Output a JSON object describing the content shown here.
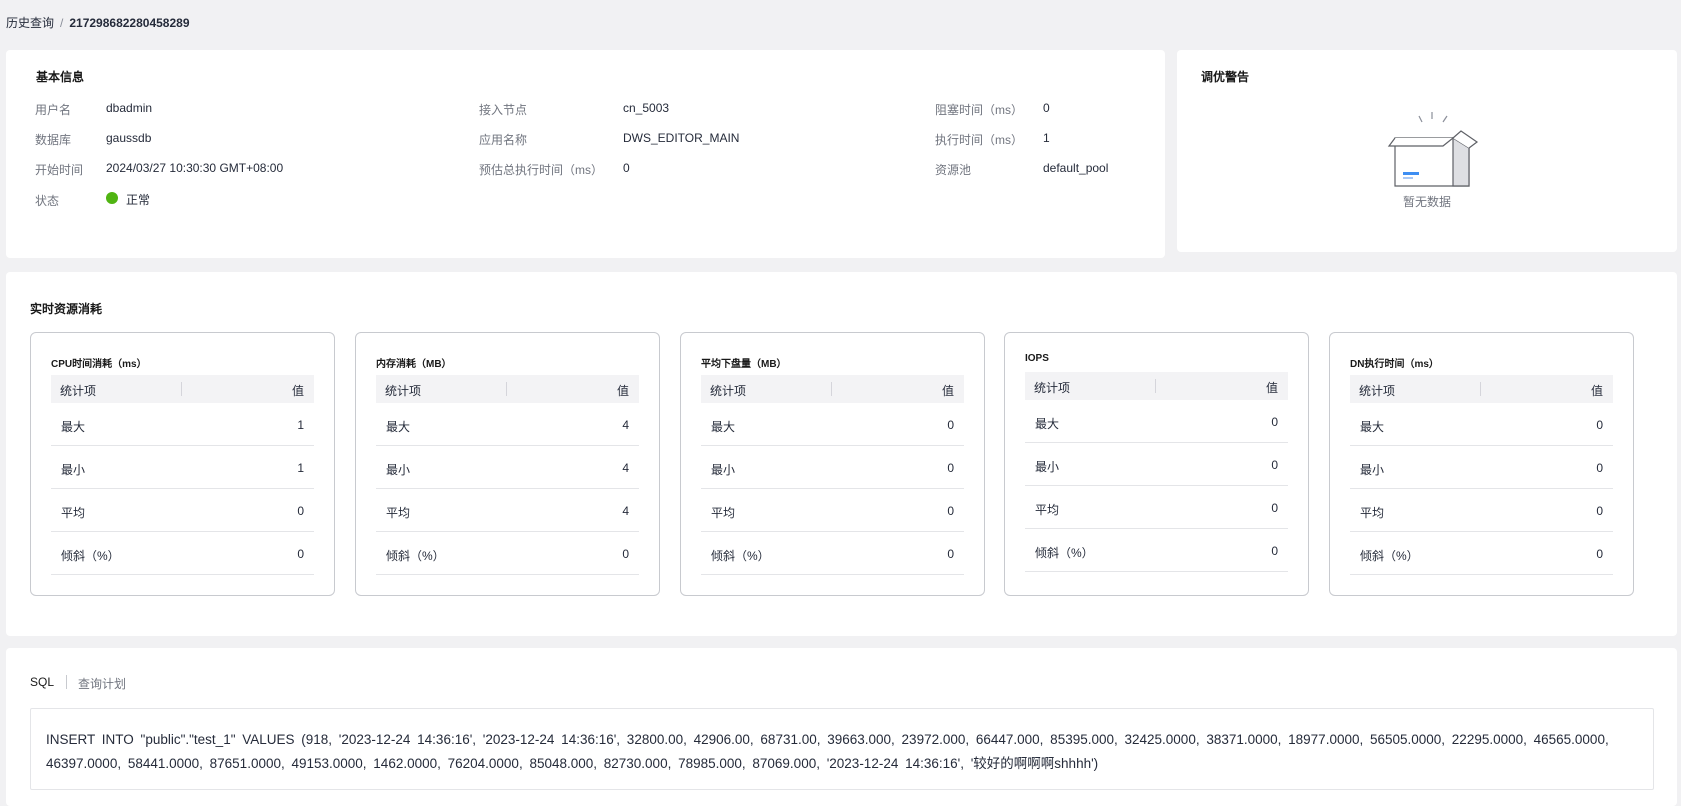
{
  "breadcrumb": {
    "parent": "历史查询",
    "separator": "/",
    "current": "217298682280458289"
  },
  "basic": {
    "title": "基本信息",
    "user_label": "用户名",
    "user": "dbadmin",
    "db_label": "数据库",
    "db": "gaussdb",
    "start_label": "开始时间",
    "start": "2024/03/27 10:30:30 GMT+08:00",
    "status_label": "状态",
    "status": "正常",
    "node_label": "接入节点",
    "node": "cn_5003",
    "app_label": "应用名称",
    "app": "DWS_EDITOR_MAIN",
    "est_label": "预估总执行时间（ms）",
    "est": "0",
    "block_label": "阻塞时间（ms）",
    "block": "0",
    "exec_label": "执行时间（ms）",
    "exec": "1",
    "pool_label": "资源池",
    "pool": "default_pool",
    "status_color": "#50b412"
  },
  "tuning": {
    "title": "调优警告",
    "empty_text": "暂无数据"
  },
  "resources": {
    "title": "实时资源消耗",
    "col_item": "统计项",
    "col_value": "值",
    "metrics": [
      {
        "title": "CPU时间消耗（ms）",
        "rows": [
          {
            "label": "最大",
            "value": "1"
          },
          {
            "label": "最小",
            "value": "1"
          },
          {
            "label": "平均",
            "value": "0"
          },
          {
            "label": "倾斜（%）",
            "value": "0"
          }
        ]
      },
      {
        "title": "内存消耗（MB）",
        "rows": [
          {
            "label": "最大",
            "value": "4"
          },
          {
            "label": "最小",
            "value": "4"
          },
          {
            "label": "平均",
            "value": "4"
          },
          {
            "label": "倾斜（%）",
            "value": "0"
          }
        ]
      },
      {
        "title": "平均下盘量（MB）",
        "rows": [
          {
            "label": "最大",
            "value": "0"
          },
          {
            "label": "最小",
            "value": "0"
          },
          {
            "label": "平均",
            "value": "0"
          },
          {
            "label": "倾斜（%）",
            "value": "0"
          }
        ]
      },
      {
        "title": "IOPS",
        "rows": [
          {
            "label": "最大",
            "value": "0"
          },
          {
            "label": "最小",
            "value": "0"
          },
          {
            "label": "平均",
            "value": "0"
          },
          {
            "label": "倾斜（%）",
            "value": "0"
          }
        ]
      },
      {
        "title": "DN执行时间（ms）",
        "rows": [
          {
            "label": "最大",
            "value": "0"
          },
          {
            "label": "最小",
            "value": "0"
          },
          {
            "label": "平均",
            "value": "0"
          },
          {
            "label": "倾斜（%）",
            "value": "0"
          }
        ]
      }
    ]
  },
  "sql": {
    "tab_sql": "SQL",
    "tab_plan": "查询计划",
    "text": "INSERT INTO \"public\".\"test_1\" VALUES (918, '2023-12-24 14:36:16', '2023-12-24 14:36:16', 32800.00, 42906.00, 68731.00, 39663.000, 23972.000, 66447.000, 85395.000, 32425.0000, 38371.0000, 18977.0000, 56505.0000, 22295.0000, 46565.0000, 46397.0000, 58441.0000, 87651.0000, 49153.0000, 1462.0000, 76204.0000, 85048.000, 82730.000, 78985.000, 87069.000, '2023-12-24 14:36:16', '较好的啊啊啊shhhh')"
  }
}
